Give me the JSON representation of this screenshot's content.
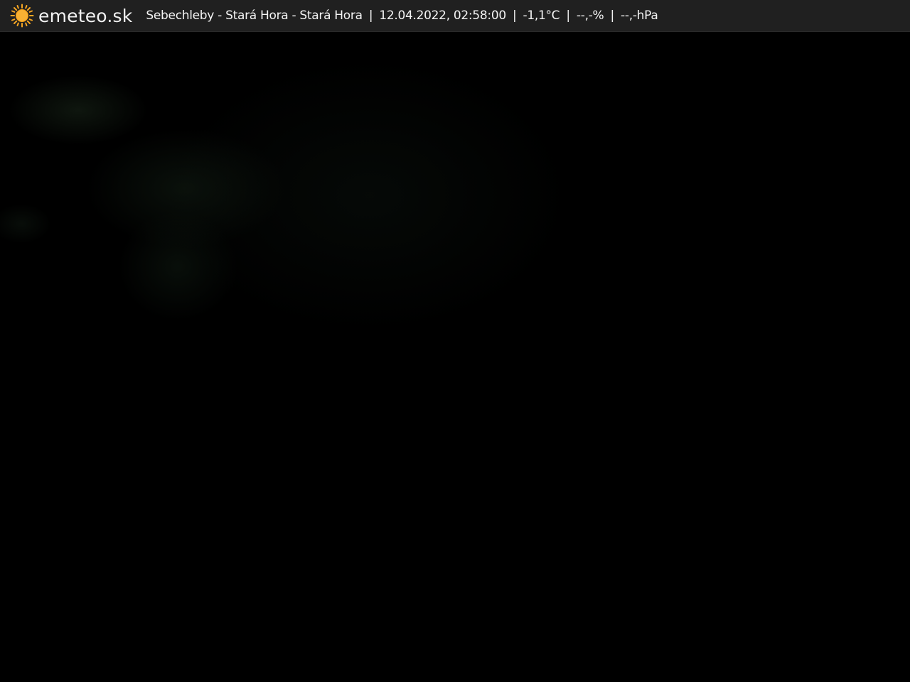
{
  "header": {
    "logo_text": "emeteo.sk",
    "location": "Sebechleby - Stará Hora - Stará Hora",
    "datetime": "12.04.2022, 02:58:00",
    "temperature": "-1,1°C",
    "humidity": "--,-%",
    "pressure": "--,-hPa",
    "separator": "|",
    "logo_icon": "sun-icon",
    "logo_color": "#f6a623"
  }
}
